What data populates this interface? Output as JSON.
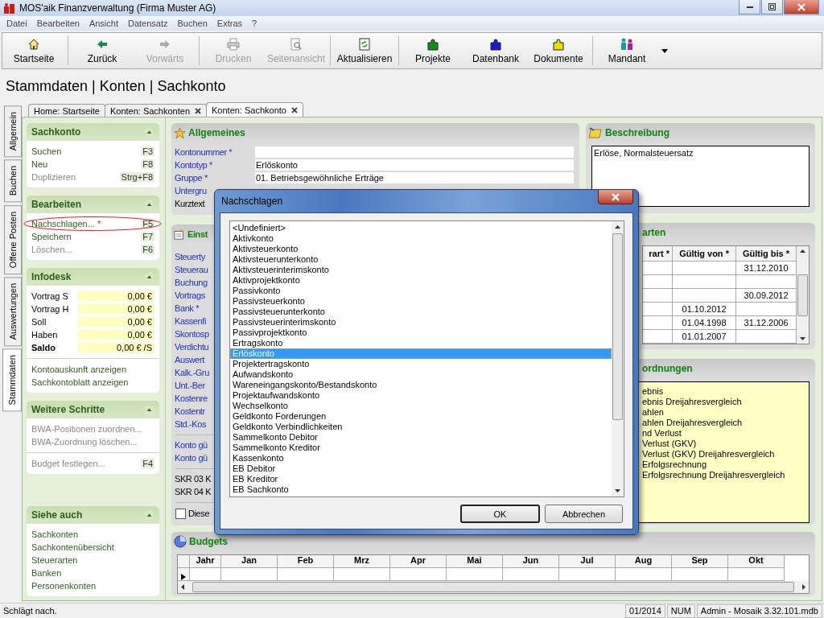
{
  "window": {
    "title": "MOS'aik Finanzverwaltung (Firma Muster AG)"
  },
  "menu": [
    {
      "label": "Datei"
    },
    {
      "label": "Bearbeiten"
    },
    {
      "label": "Ansicht"
    },
    {
      "label": "Datensatz"
    },
    {
      "label": "Buchen"
    },
    {
      "label": "Extras"
    },
    {
      "label": "?"
    }
  ],
  "toolbar": [
    [
      {
        "label": "Startseite",
        "kind": "home",
        "disabled": false
      }
    ],
    [
      {
        "label": "Zurück",
        "kind": "back",
        "disabled": false
      },
      {
        "label": "Vorwärts",
        "kind": "forward",
        "disabled": true
      }
    ],
    [
      {
        "label": "Drucken",
        "kind": "print",
        "disabled": true
      },
      {
        "label": "Seitenansicht",
        "kind": "preview",
        "disabled": true
      }
    ],
    [
      {
        "label": "Aktualisieren",
        "kind": "refresh",
        "disabled": false
      }
    ],
    [
      {
        "label": "Projekte",
        "kind": "puzzle",
        "color": "#1a8a1a",
        "disabled": false
      },
      {
        "label": "Datenbank",
        "kind": "puzzle",
        "color": "#1a1ad0",
        "disabled": false
      },
      {
        "label": "Dokumente",
        "kind": "puzzle",
        "color": "#e8e000",
        "disabled": false
      }
    ],
    [
      {
        "label": "Mandant",
        "kind": "people",
        "disabled": false
      }
    ]
  ],
  "breadcrumb": "Stammdaten | Konten | Sachkonto",
  "side_tabs": [
    {
      "label": "Allgemein",
      "selected": false
    },
    {
      "label": "Buchen",
      "selected": false
    },
    {
      "label": "Offene Posten",
      "selected": false
    },
    {
      "label": "Auswertungen",
      "selected": false
    },
    {
      "label": "Stammdaten",
      "selected": true
    }
  ],
  "doc_tabs": [
    {
      "label": "Home: Startseite",
      "selected": false,
      "closable": false
    },
    {
      "label": "Konten: Sachkonten",
      "selected": false,
      "closable": true
    },
    {
      "label": "Konten: Sachkonto",
      "selected": true,
      "closable": true
    }
  ],
  "sidebar": [
    {
      "title": "Sachkonto",
      "groups": [
        {
          "kind": "links",
          "items": [
            {
              "label": "Suchen",
              "shortcut": "F3",
              "disabled": false,
              "highlighted": false
            },
            {
              "label": "Neu",
              "shortcut": "F8",
              "disabled": false,
              "highlighted": false
            },
            {
              "label": "Duplizieren",
              "shortcut": "Strg+F8",
              "disabled": true,
              "highlighted": false
            }
          ]
        }
      ]
    },
    {
      "title": "Bearbeiten",
      "groups": [
        {
          "kind": "links",
          "items": [
            {
              "label": "Nachschlagen... *",
              "shortcut": "F5",
              "disabled": false,
              "highlighted": true
            },
            {
              "label": "Speichern",
              "shortcut": "F7",
              "disabled": false,
              "highlighted": false
            },
            {
              "label": "Löschen...",
              "shortcut": "F6",
              "disabled": true,
              "highlighted": false
            }
          ]
        }
      ]
    },
    {
      "title": "Infodesk",
      "groups": [
        {
          "kind": "values",
          "items": [
            {
              "label": "Vortrag S",
              "value": "0,00 €",
              "bold": false
            },
            {
              "label": "Vortrag H",
              "value": "0,00 €",
              "bold": false
            },
            {
              "label": "Soll",
              "value": "0,00 €",
              "bold": false
            },
            {
              "label": "Haben",
              "value": "0,00 €",
              "bold": false
            },
            {
              "label": "Saldo",
              "value": "0,00 € /S",
              "bold": true
            }
          ]
        },
        {
          "kind": "links",
          "items": [
            {
              "label": "Kontoauskunft anzeigen",
              "disabled": false,
              "highlighted": false
            },
            {
              "label": "Sachkontoblatt anzeigen",
              "disabled": false,
              "highlighted": false
            }
          ]
        }
      ]
    },
    {
      "title": "Weitere Schritte",
      "groups": [
        {
          "kind": "links",
          "items": [
            {
              "label": "BWA-Positionen zuordnen...",
              "disabled": true,
              "highlighted": false
            },
            {
              "label": "BWA-Zuordnung löschen...",
              "disabled": true,
              "highlighted": false
            }
          ]
        },
        {
          "kind": "links",
          "items": [
            {
              "label": "Budget festlegen...",
              "shortcut": "F4",
              "disabled": true,
              "highlighted": false
            }
          ]
        }
      ]
    },
    {
      "title": "Siehe auch",
      "groups": [
        {
          "kind": "links",
          "items": [
            {
              "label": "Sachkonten",
              "disabled": false,
              "highlighted": false
            },
            {
              "label": "Sachkontenübersicht",
              "disabled": false,
              "highlighted": false
            },
            {
              "label": "Steuerarten",
              "disabled": false,
              "highlighted": false
            },
            {
              "label": "Banken",
              "disabled": false,
              "highlighted": false
            },
            {
              "label": "Personenkonten",
              "disabled": false,
              "highlighted": false
            }
          ]
        }
      ]
    }
  ],
  "general": {
    "title": "Allgemeines",
    "fields": [
      {
        "label": "Kontonummer *",
        "link": true,
        "field": true
      },
      {
        "label": "Kontotyp *",
        "link": true,
        "field": true,
        "value": "Erlöskonto"
      },
      {
        "label": "Gruppe *",
        "link": true,
        "field": true,
        "value": "01. Betriebsgewöhnliche Erträge"
      },
      {
        "label": "Untergru",
        "link": true,
        "field": false
      },
      {
        "label": "Kurztext",
        "link": false,
        "field": false
      }
    ]
  },
  "settings": {
    "title": "Einst",
    "groups": [
      [
        {
          "label": "Steuerty",
          "link": true
        },
        {
          "label": "Steuerau",
          "link": true
        },
        {
          "label": "Buchung",
          "link": true
        },
        {
          "label": "Vortrags",
          "link": true
        },
        {
          "label": "Bank *",
          "link": true
        },
        {
          "label": "Kassenfi",
          "link": true
        },
        {
          "label": "Skontosp",
          "link": true
        },
        {
          "label": "Verdichtu",
          "link": true
        },
        {
          "label": "Auswert",
          "link": true
        },
        {
          "label": "Kalk.-Gru",
          "link": true
        },
        {
          "label": "Unt.-Ber",
          "link": true
        },
        {
          "label": "Kostenre",
          "link": true
        },
        {
          "label": "Kostentr",
          "link": true
        },
        {
          "label": "Std.-Kos",
          "link": true
        }
      ],
      [
        {
          "label": "Konto gü",
          "link": true
        },
        {
          "label": "Konto gü",
          "link": true
        }
      ],
      [
        {
          "label": "SKR 03 K",
          "link": false
        },
        {
          "label": "SKR 04 K",
          "link": false
        }
      ]
    ],
    "checkbox": {
      "label": "Diese",
      "checked": false
    }
  },
  "budgets": {
    "title": "Budgets",
    "columns": [
      "Jahr",
      "Jan",
      "Feb",
      "Mrz",
      "Apr",
      "Mai",
      "Jun",
      "Jul",
      "Aug",
      "Sep",
      "Okt"
    ]
  },
  "description": {
    "title": "Beschreibung",
    "text": "Erlöse, Normalsteuersatz"
  },
  "tax_types": {
    "title": "arten",
    "columns": [
      "rart *",
      "Gültig von *",
      "Gültig bis *"
    ],
    "rows": [
      {
        "valid_to": "31.12.2010"
      },
      {},
      {
        "valid_to": "30.09.2012"
      },
      {
        "valid_from": "01.10.2012"
      },
      {
        "valid_from": "01.04.1998",
        "valid_to": "31.12.2006"
      },
      {
        "valid_from": "01.01.2007"
      }
    ]
  },
  "assignments": {
    "title": "ordnungen",
    "items": [
      "ebnis",
      "ebnis Dreijahresvergleich",
      "ahlen",
      "ahlen Dreijahresvergleich",
      "nd Verlust",
      "Verlust (GKV)",
      "Verlust (GKV) Dreijahresvergleich",
      "Erfolgsrechnung",
      "Erfolgsrechnung Dreijahresvergleich"
    ]
  },
  "dialog": {
    "title": "Nachschlagen",
    "items": [
      {
        "label": "<Undefiniert>",
        "selected": false
      },
      {
        "label": "Aktivkonto",
        "selected": false
      },
      {
        "label": "Aktivsteuerkonto",
        "selected": false
      },
      {
        "label": "Aktivsteuerunterkonto",
        "selected": false
      },
      {
        "label": "Aktivsteuerinterimskonto",
        "selected": false
      },
      {
        "label": "Aktivprojektkonto",
        "selected": false
      },
      {
        "label": "Passivkonto",
        "selected": false
      },
      {
        "label": "Passivsteuerkonto",
        "selected": false
      },
      {
        "label": "Passivsteuerunterkonto",
        "selected": false
      },
      {
        "label": "Passivsteuerinterimskonto",
        "selected": false
      },
      {
        "label": "Passivprojektkonto",
        "selected": false
      },
      {
        "label": "Ertragskonto",
        "selected": false
      },
      {
        "label": "Erlöskonto",
        "selected": true
      },
      {
        "label": "Projektertragskonto",
        "selected": false
      },
      {
        "label": "Aufwandskonto",
        "selected": false
      },
      {
        "label": "Wareneingangskonto/Bestandskonto",
        "selected": false
      },
      {
        "label": "Projektaufwandskonto",
        "selected": false
      },
      {
        "label": "Wechselkonto",
        "selected": false
      },
      {
        "label": "Geldkonto Forderungen",
        "selected": false
      },
      {
        "label": "Geldkonto Verbindlichkeiten",
        "selected": false
      },
      {
        "label": "Sammelkonto Debitor",
        "selected": false
      },
      {
        "label": "Sammelkonto Kreditor",
        "selected": false
      },
      {
        "label": "Kassenkonto",
        "selected": false
      },
      {
        "label": "EB Debitor",
        "selected": false
      },
      {
        "label": "EB Kreditor",
        "selected": false
      },
      {
        "label": "EB Sachkonto",
        "selected": false
      }
    ],
    "buttons": [
      {
        "label": "OK",
        "default": true
      },
      {
        "label": "Abbrechen",
        "default": false
      }
    ]
  },
  "status_bar": {
    "message": "Schlägt nach.",
    "period": "01/2014",
    "num": "NUM",
    "database": "Admin - Mosaik 3.32.101.mdb"
  }
}
